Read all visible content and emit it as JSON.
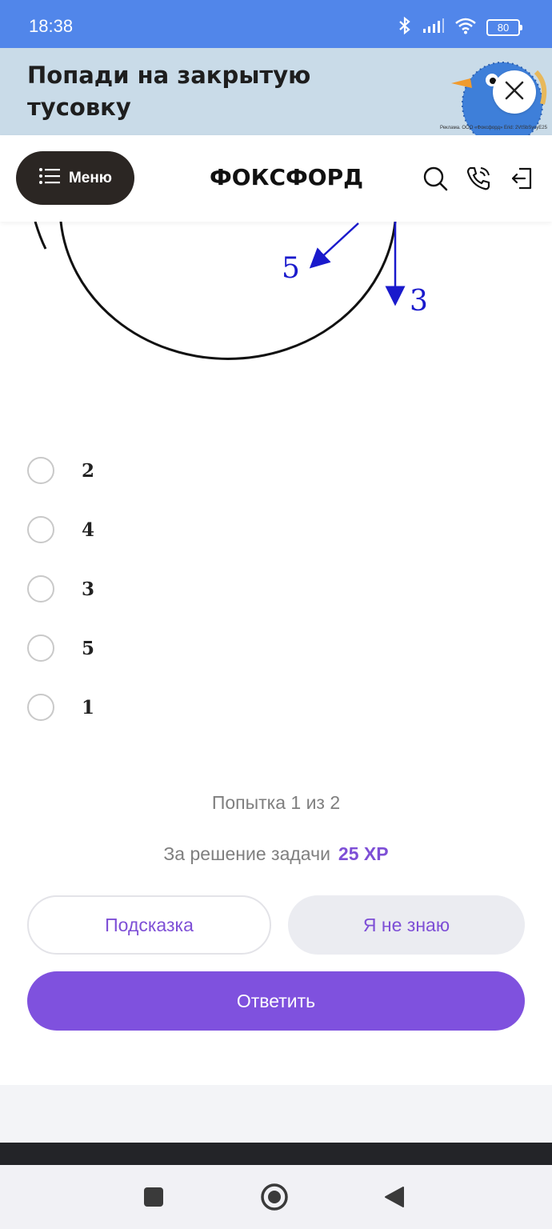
{
  "status_bar": {
    "time": "18:38",
    "battery": "80"
  },
  "ad": {
    "title": "Попади на закрытую тусовку",
    "legal": "Реклама. ООО «Фоксфорд» Erid: 2VtSbSycyE25"
  },
  "header": {
    "menu_label": "Меню",
    "logo": "ФОКСФОРД"
  },
  "diagram": {
    "arrow_labels": [
      "5",
      "3"
    ]
  },
  "options": [
    {
      "label": "2"
    },
    {
      "label": "4"
    },
    {
      "label": "3"
    },
    {
      "label": "5"
    },
    {
      "label": "1"
    }
  ],
  "attempt_text": "Попытка 1 из 2",
  "reward": {
    "text": "За решение задачи",
    "xp": "25 XP"
  },
  "buttons": {
    "hint": "Подсказка",
    "dont_know": "Я не знаю",
    "answer": "Ответить"
  },
  "colors": {
    "accent": "#7f51de",
    "status_bar": "#5186ea",
    "diagram_arrows": "#1a1acc"
  },
  "icons": [
    "bluetooth-icon",
    "signal-icon",
    "wifi-icon",
    "search-icon",
    "phone-icon",
    "login-icon",
    "close-icon"
  ]
}
